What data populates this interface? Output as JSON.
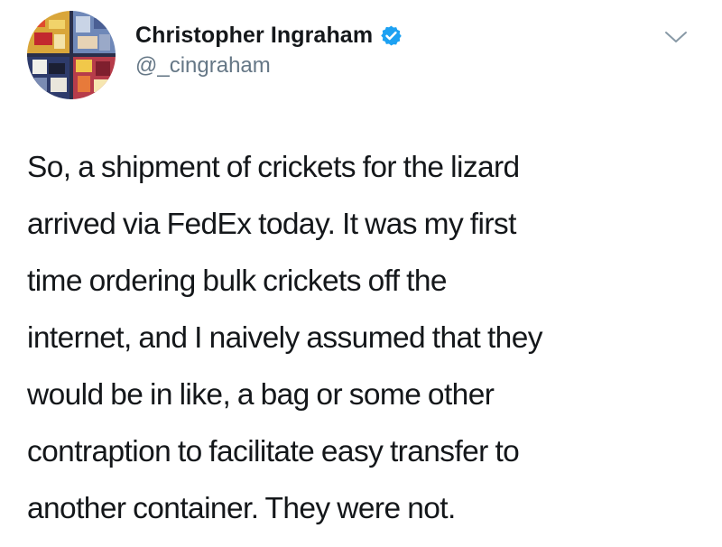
{
  "tweet": {
    "author": {
      "display_name": "Christopher Ingraham",
      "handle": "@_cingraham",
      "verified": true,
      "avatar_icon": "avatar-image"
    },
    "menu_icon": "chevron-down-icon",
    "text": "So, a shipment of crickets for the lizard\narrived via FedEx today. It was my first\ntime ordering bulk crickets off the\ninternet, and I naively assumed that they\nwould be in like, a bag or some other\ncontraption to facilitate easy transfer to\nanother container. They were not."
  },
  "colors": {
    "name": "#14171a",
    "handle": "#657786",
    "verified": "#1da1f2",
    "chevron": "#8899a6",
    "background": "#ffffff"
  }
}
